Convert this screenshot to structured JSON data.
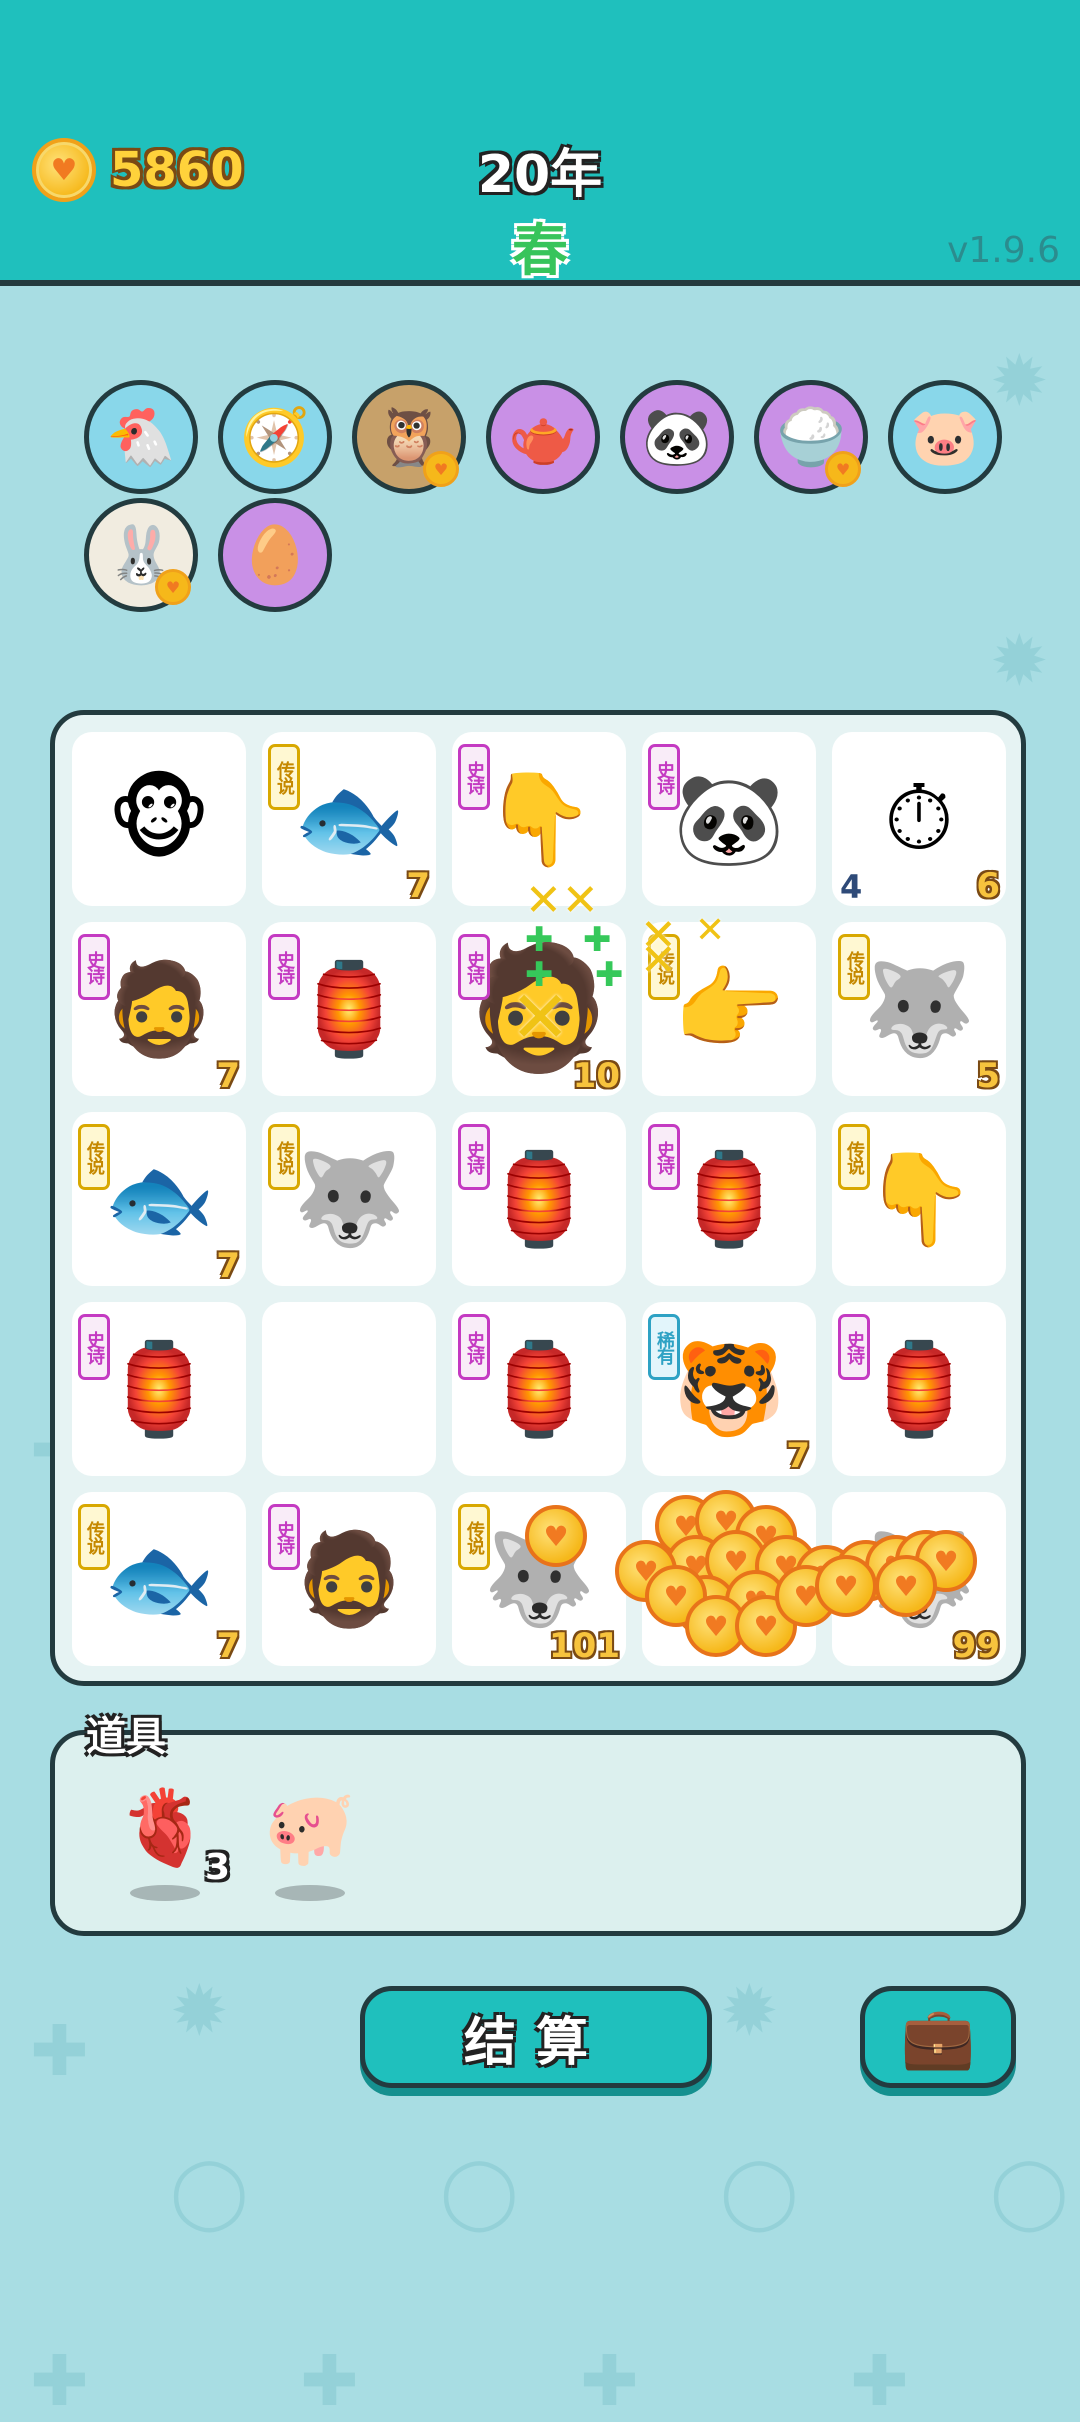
{
  "header": {
    "coins": "5860",
    "year": "20年",
    "season": "春",
    "version": "v1.9.6"
  },
  "collection": [
    {
      "name": "chicken-egg-icon",
      "glyph": "🐔",
      "bg": "blue",
      "badge": false
    },
    {
      "name": "compass-icon",
      "glyph": "🧭",
      "bg": "blue",
      "badge": false
    },
    {
      "name": "owls-icon",
      "glyph": "🦉",
      "bg": "brown",
      "badge": true
    },
    {
      "name": "gravy-boat-icon",
      "glyph": "🫖",
      "bg": "purple",
      "badge": false
    },
    {
      "name": "panda-icon",
      "glyph": "🐼",
      "bg": "purple",
      "badge": false
    },
    {
      "name": "rice-bowl-icon",
      "glyph": "🍚",
      "bg": "purple",
      "badge": true
    },
    {
      "name": "piggy-bank-icon",
      "glyph": "🐷",
      "bg": "blue",
      "badge": false
    },
    {
      "name": "rabbit-icon",
      "glyph": "🐰",
      "bg": "cream",
      "badge": true
    },
    {
      "name": "egg-icon",
      "glyph": "🥚",
      "bg": "purple",
      "badge": false
    }
  ],
  "board": [
    {
      "name": "monkey-icon",
      "glyph": "🐵",
      "tag": "",
      "count": ""
    },
    {
      "name": "koi-fish-icon",
      "glyph": "🐟",
      "tag": "传说",
      "tagType": "legend",
      "count": "7"
    },
    {
      "name": "gray-hand-icon",
      "glyph": "👇",
      "tag": "史诗",
      "tagType": "epic",
      "count": ""
    },
    {
      "name": "panda-icon",
      "glyph": "🐼",
      "tag": "史诗",
      "tagType": "epic",
      "count": ""
    },
    {
      "name": "stopwatch-icon",
      "glyph": "⏱",
      "tag": "",
      "count": "6",
      "leftCount": "4"
    },
    {
      "name": "green-hair-man-icon",
      "glyph": "🧔",
      "tag": "史诗",
      "tagType": "epic",
      "count": "7"
    },
    {
      "name": "rabbit-house-icon",
      "glyph": "🏮",
      "tag": "史诗",
      "tagType": "epic",
      "count": ""
    },
    {
      "name": "big-green-hair-man-icon",
      "glyph": "🧔",
      "tag": "史诗",
      "tagType": "epic",
      "count": "10"
    },
    {
      "name": "golden-hand-icon",
      "glyph": "👉",
      "tag": "传说",
      "tagType": "legend",
      "count": ""
    },
    {
      "name": "crowned-husky-icon",
      "glyph": "🐺",
      "tag": "传说",
      "tagType": "legend",
      "count": "5"
    },
    {
      "name": "koi-fish-icon",
      "glyph": "🐟",
      "tag": "传说",
      "tagType": "legend",
      "count": "7"
    },
    {
      "name": "crowned-husky-icon",
      "glyph": "🐺",
      "tag": "传说",
      "tagType": "legend",
      "count": ""
    },
    {
      "name": "rabbit-house-icon",
      "glyph": "🏮",
      "tag": "史诗",
      "tagType": "epic",
      "count": ""
    },
    {
      "name": "rabbit-house-icon",
      "glyph": "🏮",
      "tag": "史诗",
      "tagType": "epic",
      "count": ""
    },
    {
      "name": "golden-hand-icon",
      "glyph": "👇",
      "tag": "传说",
      "tagType": "legend",
      "count": ""
    },
    {
      "name": "rabbit-house-icon",
      "glyph": "🏮",
      "tag": "史诗",
      "tagType": "epic",
      "count": ""
    },
    {
      "name": "empty-tile",
      "glyph": "",
      "tag": "",
      "count": ""
    },
    {
      "name": "rabbit-house-icon",
      "glyph": "🏮",
      "tag": "史诗",
      "tagType": "epic",
      "count": ""
    },
    {
      "name": "tiger-icon",
      "glyph": "🐯",
      "tag": "稀有",
      "tagType": "rare",
      "count": "7"
    },
    {
      "name": "rabbit-house-icon",
      "glyph": "🏮",
      "tag": "史诗",
      "tagType": "epic",
      "count": ""
    },
    {
      "name": "koi-fish-icon",
      "glyph": "🐟",
      "tag": "传说",
      "tagType": "legend",
      "count": "7"
    },
    {
      "name": "green-hair-man-icon",
      "glyph": "🧔",
      "tag": "史诗",
      "tagType": "epic",
      "count": ""
    },
    {
      "name": "husky-icon",
      "glyph": "🐺",
      "tag": "传说",
      "tagType": "legend",
      "count": "101"
    },
    {
      "name": "coin-pile-icon",
      "glyph": "",
      "tag": "",
      "count": ""
    },
    {
      "name": "husky-icon",
      "glyph": "🐺",
      "tag": "",
      "count": "99"
    }
  ],
  "items": {
    "title": "道具",
    "list": [
      {
        "name": "liver-icon",
        "glyph": "🫀",
        "count": "3"
      },
      {
        "name": "piggy-bank-icon",
        "glyph": "🐖",
        "count": ""
      }
    ]
  },
  "buttons": {
    "settle": "结算",
    "bag_icon": "briefcase-icon"
  }
}
